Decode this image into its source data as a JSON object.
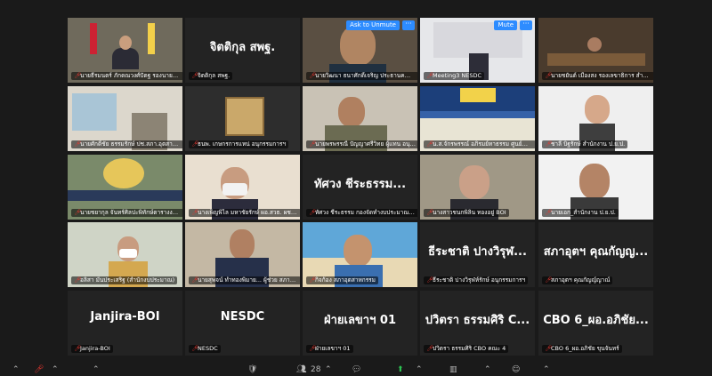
{
  "meeting": {
    "unmute_label": "Ask to Unmute",
    "mute_label": "Mute",
    "more_label": "···",
    "participant_count": "28"
  },
  "tiles": [
    {
      "name": "นายธีรมนตร์ ภักดณวงศ์ปัตฐ รองนายกรัฐมนตรี...",
      "type": "video",
      "scene": "office-flags",
      "active": true
    },
    {
      "name": "จิตติกุล สพฐ.",
      "type": "text",
      "display": "จิตติกุล สพฐ."
    },
    {
      "name": "นายวิฒนา ธนาศักดิ์เจริญ ประธานคณะกรรมการ...",
      "type": "video",
      "scene": "man-glasses",
      "unmute": true
    },
    {
      "name": "Meeting3 NESDC",
      "type": "video",
      "scene": "podium",
      "mute": true
    },
    {
      "name": "นายชยันต์ เมืองสง รองเลขาธิการ สำนักงาน...",
      "type": "video",
      "scene": "conference-room"
    },
    {
      "name": "นายศักดิ์ชัย ธรรมรักษ์ ปช.สภา.อุตสาหกรรม...",
      "type": "video",
      "scene": "office-wall"
    },
    {
      "name": "ธนพ. เกษกรการแหน่ อนุกรรมการฯ",
      "type": "video",
      "scene": "portrait-frame"
    },
    {
      "name": "นายพรพรรณี ปัญญาศรีวิทย ผู้แทน อนุกรรม...",
      "type": "video",
      "scene": "officer-desk"
    },
    {
      "name": "น.ส.จักรพรรณ์ อภิรมย์ทาธรรม ศูนย์อำนวยการบริหาร...",
      "type": "video",
      "scene": "banner-sign"
    },
    {
      "name": "ชาลี บิฐรักษ์ สำนักงาน ป.ย.ป.",
      "type": "video",
      "scene": "woman-logo"
    },
    {
      "name": "นายชยากุล จันทร์ศิลปะพิทักษ์ตารางงานรอง...",
      "type": "video",
      "scene": "emblem"
    },
    {
      "name": "นางเพ็ญพิไล มหาชัยรักษ์ ผอ.สวธ. ผชน. ปกป...",
      "type": "video",
      "scene": "woman-mask"
    },
    {
      "name": "ทัศวง ชีระธรรม กองจัดทำงบประมาณเขต...",
      "type": "text",
      "display": "ทัศวง ชีระธรรม..."
    },
    {
      "name": "นางสาวชนกพิลิน ทองอยู่ BOI",
      "type": "video",
      "scene": "woman-glasses"
    },
    {
      "name": "นายเอก_สำนักงาน ป.ย.ป.",
      "type": "video",
      "scene": "man-logo"
    },
    {
      "name": "อลิสา มั่นประเสริฐ (สำนักงบประมาณ)",
      "type": "video",
      "scene": "woman-mask-2"
    },
    {
      "name": "นายสุพจน์ ทำทองพิมาย... ผู้ช่วย สภาอุตสาหกรรม...",
      "type": "video",
      "scene": "man-suit"
    },
    {
      "name": "กิจก้อง สภาอุตสาหกรรม",
      "type": "video",
      "scene": "beach-man"
    },
    {
      "name": "ธีระชาติ ปางวิรุฬห์รักษ์ อนุกรรมการฯ",
      "type": "text",
      "display": "ธีระชาติ ปางวิรุฬ..."
    },
    {
      "name": "สภาอุตฯ คุณกัญญ์ญาณ์",
      "type": "text",
      "display": "สภาอุตฯ คุณกัญญ..."
    },
    {
      "name": "Janjira-BOI",
      "type": "text",
      "display": "Janjira-BOI"
    },
    {
      "name": "NESDC",
      "type": "text",
      "display": "NESDC"
    },
    {
      "name": "ฝ่ายเลขาฯ 01",
      "type": "text",
      "display": "ฝ่ายเลขาฯ 01"
    },
    {
      "name": "ปวิตรา ธรรมศิริ CBO คณะ 4",
      "type": "text",
      "display": "ปวิตรา ธรรมศิริ C..."
    },
    {
      "name": "CBO 6_ผอ.อภิชัย ขุนจันทร์",
      "type": "text",
      "display": "CBO 6_ผอ.อภิชัย..."
    }
  ]
}
